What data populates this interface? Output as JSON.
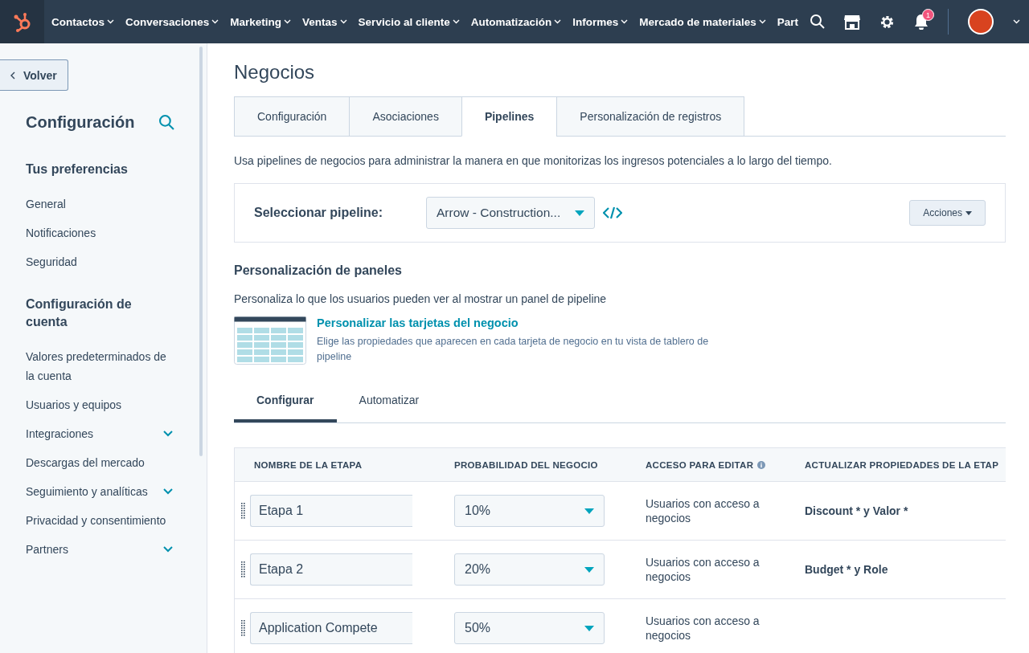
{
  "topnav": {
    "items": [
      {
        "label": "Contactos",
        "has_menu": true
      },
      {
        "label": "Conversaciones",
        "has_menu": true
      },
      {
        "label": "Marketing",
        "has_menu": true
      },
      {
        "label": "Ventas",
        "has_menu": true
      },
      {
        "label": "Servicio al cliente",
        "has_menu": true
      },
      {
        "label": "Automatización",
        "has_menu": true
      },
      {
        "label": "Informes",
        "has_menu": true
      },
      {
        "label": "Mercado de materiales",
        "has_menu": true
      },
      {
        "label": "Part",
        "has_menu": false
      }
    ],
    "notification_count": "1"
  },
  "sidebar": {
    "back_label": "Volver",
    "title": "Configuración",
    "sections": [
      {
        "title": "Tus preferencias",
        "items": [
          {
            "label": "General",
            "expandable": false
          },
          {
            "label": "Notificaciones",
            "expandable": false
          },
          {
            "label": "Seguridad",
            "expandable": false
          }
        ]
      },
      {
        "title": "Configuración de cuenta",
        "items": [
          {
            "label": "Valores predeterminados de la cuenta",
            "expandable": false
          },
          {
            "label": "Usuarios y equipos",
            "expandable": false
          },
          {
            "label": "Integraciones",
            "expandable": true
          },
          {
            "label": "Descargas del mercado",
            "expandable": false
          },
          {
            "label": "Seguimiento y analíticas",
            "expandable": true
          },
          {
            "label": "Privacidad y consentimiento",
            "expandable": false
          },
          {
            "label": "Partners",
            "expandable": true
          }
        ]
      }
    ]
  },
  "page": {
    "title": "Negocios",
    "tabs": [
      {
        "label": "Configuración",
        "selected": false
      },
      {
        "label": "Asociaciones",
        "selected": false
      },
      {
        "label": "Pipelines",
        "selected": true
      },
      {
        "label": "Personalización de registros",
        "selected": false
      }
    ],
    "description": "Usa pipelines de negocios para administrar la manera en que monitorizas los ingresos potenciales a lo largo del tiempo.",
    "pipeline_label": "Seleccionar pipeline:",
    "pipeline_value": "Arrow - Construction...",
    "actions_label": "Acciones",
    "panels": {
      "title": "Personalización de paneles",
      "description": "Personaliza lo que los usuarios pueden ver al mostrar un panel de pipeline",
      "card_link": "Personalizar las tarjetas del negocio",
      "card_description": "Elige las propiedades que aparecen en cada tarjeta de negocio en tu vista de tablero de pipeline"
    },
    "subtabs": [
      {
        "label": "Configurar",
        "selected": true
      },
      {
        "label": "Automatizar",
        "selected": false
      }
    ],
    "table": {
      "columns": [
        "NOMBRE DE LA ETAPA",
        "PROBABILIDAD DEL NEGOCIO",
        "ACCESO PARA EDITAR",
        "ACTUALIZAR PROPIEDADES DE LA ETAP"
      ],
      "rows": [
        {
          "name": "Etapa 1",
          "probability": "10%",
          "access": "Usuarios con acceso a negocios",
          "properties": "Discount * y Valor *"
        },
        {
          "name": "Etapa 2",
          "probability": "20%",
          "access": "Usuarios con acceso a negocios",
          "properties": "Budget * y Role"
        },
        {
          "name": "Application Compete",
          "probability": "50%",
          "access": "Usuarios con acceso a negocios"
        }
      ]
    }
  }
}
